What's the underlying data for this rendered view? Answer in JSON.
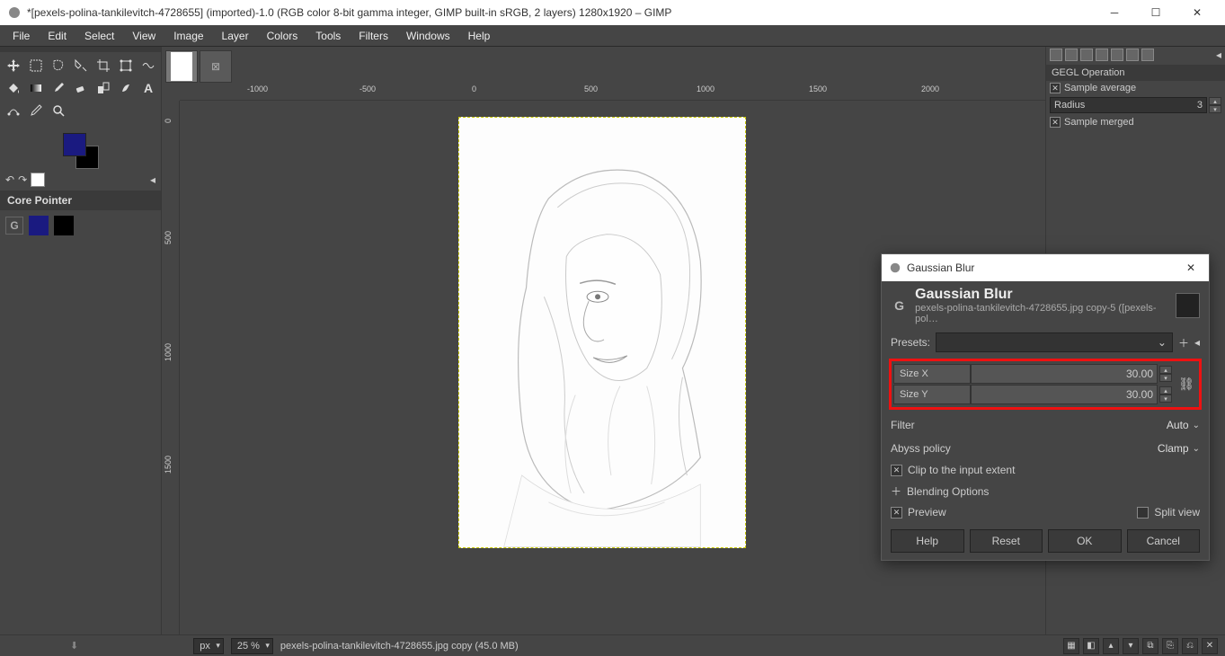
{
  "titlebar": {
    "text": "*[pexels-polina-tankilevitch-4728655] (imported)-1.0 (RGB color 8-bit gamma integer, GIMP built-in sRGB, 2 layers) 1280x1920 – GIMP"
  },
  "menu": [
    "File",
    "Edit",
    "Select",
    "View",
    "Image",
    "Layer",
    "Colors",
    "Tools",
    "Filters",
    "Windows",
    "Help"
  ],
  "ruler_h": [
    "-1000",
    "-500",
    "0",
    "500",
    "1000",
    "1500",
    "2000"
  ],
  "ruler_v": [
    "0",
    "500",
    "1000",
    "1500"
  ],
  "right_panel": {
    "title": "GEGL Operation",
    "sample_avg": "Sample average",
    "radius_label": "Radius",
    "radius_value": "3",
    "sample_merged": "Sample merged"
  },
  "core_pointer": "Core Pointer",
  "dialog": {
    "win_title": "Gaussian Blur",
    "title": "Gaussian Blur",
    "subtitle": "pexels-polina-tankilevitch-4728655.jpg copy-5 ([pexels-pol…",
    "presets_label": "Presets:",
    "size_x_label": "Size X",
    "size_x_value": "30.00",
    "size_y_label": "Size Y",
    "size_y_value": "30.00",
    "filter_label": "Filter",
    "filter_value": "Auto",
    "abyss_label": "Abyss policy",
    "abyss_value": "Clamp",
    "clip_label": "Clip to the input extent",
    "blend_label": "Blending Options",
    "preview_label": "Preview",
    "split_label": "Split view",
    "btn_help": "Help",
    "btn_reset": "Reset",
    "btn_ok": "OK",
    "btn_cancel": "Cancel"
  },
  "status": {
    "unit": "px",
    "zoom": "25 %",
    "msg": "pexels-polina-tankilevitch-4728655.jpg copy (45.0 MB)"
  }
}
